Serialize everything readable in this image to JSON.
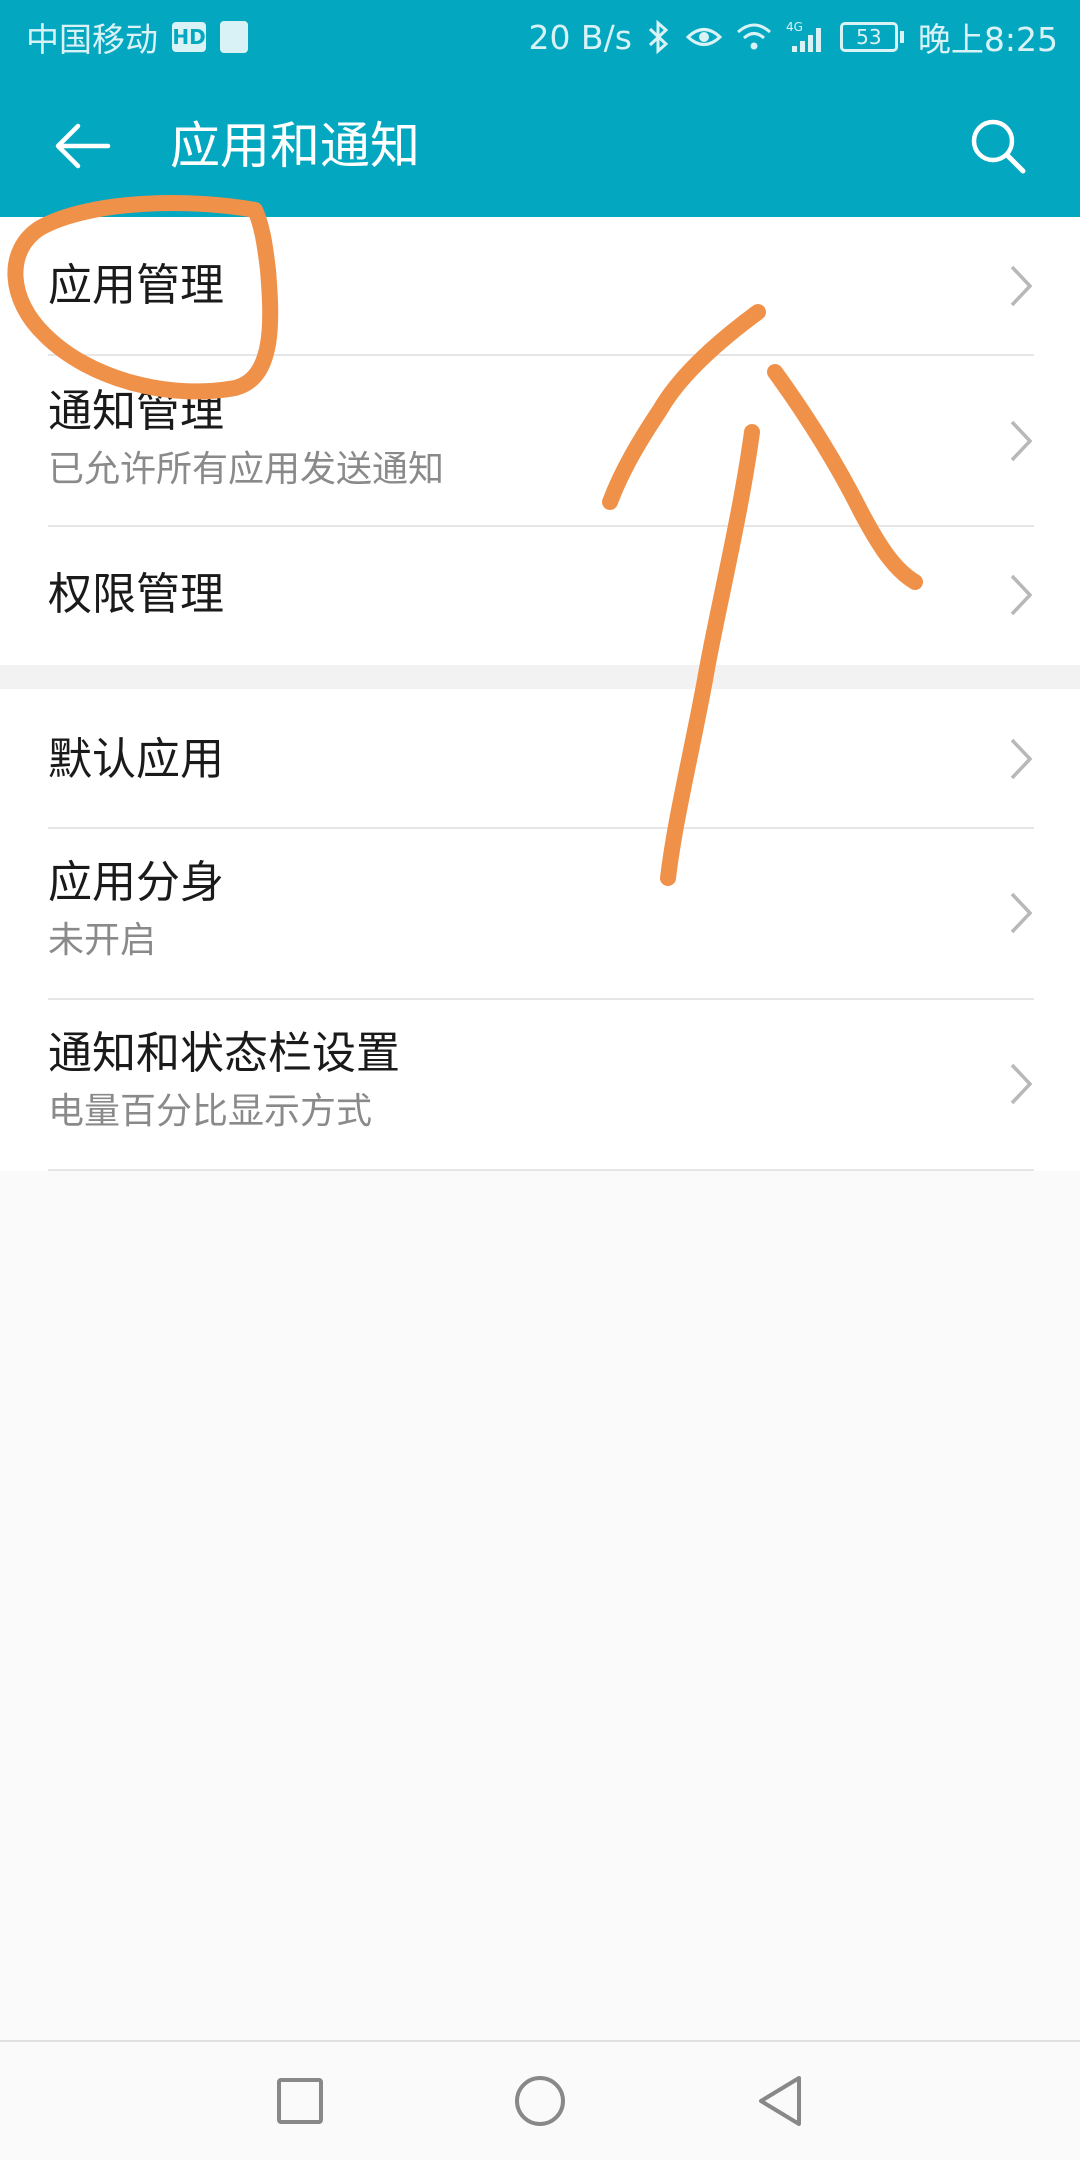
{
  "status_bar": {
    "carrier": "中国移动",
    "hd_badge": "HD",
    "net_speed": "20 B/s",
    "signal_type": "4G",
    "battery_level": "53",
    "time": "晚上8:25"
  },
  "app_bar": {
    "title": "应用和通知",
    "back_icon": "arrow-left-icon",
    "search_icon": "search-icon"
  },
  "settings_group_1": [
    {
      "title": "应用管理",
      "subtitle": ""
    },
    {
      "title": "通知管理",
      "subtitle": "已允许所有应用发送通知"
    },
    {
      "title": "权限管理",
      "subtitle": ""
    }
  ],
  "settings_group_2": [
    {
      "title": "默认应用",
      "subtitle": ""
    },
    {
      "title": "应用分身",
      "subtitle": "未开启"
    },
    {
      "title": "通知和状态栏设置",
      "subtitle": "电量百分比显示方式"
    }
  ],
  "nav_bar": {
    "recents_icon": "square-icon",
    "home_icon": "circle-icon",
    "back_icon": "triangle-back-icon"
  },
  "colors": {
    "header": "#04a7c0",
    "annotation": "#f0914a"
  }
}
